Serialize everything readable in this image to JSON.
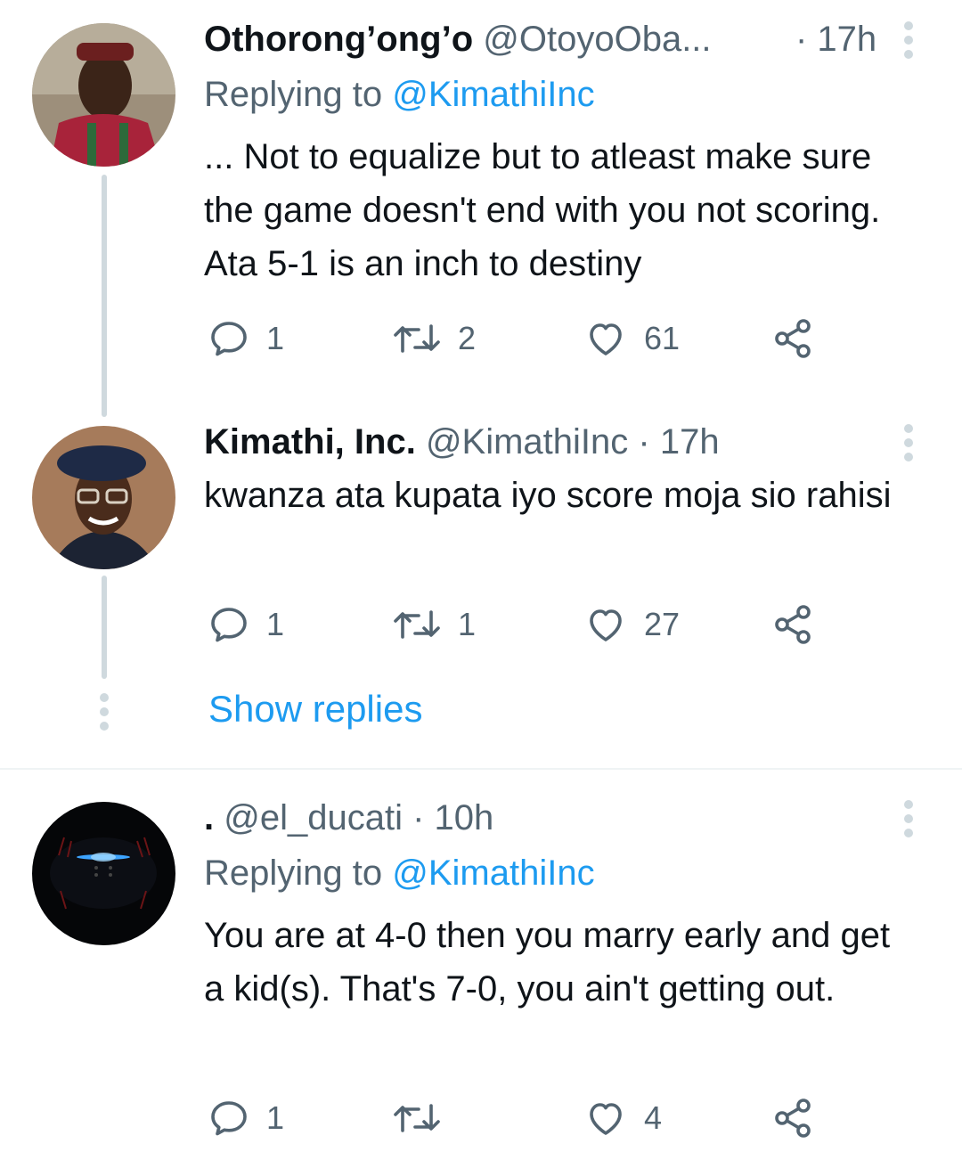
{
  "colors": {
    "accent": "#1d9bf0",
    "muted": "#536471",
    "line": "#cfd9de"
  },
  "tweets": [
    {
      "display_name": "Othorong’ong’o",
      "handle": "@OtoyoOba...",
      "time": "· 17h",
      "replying_prefix": "Replying to",
      "replying_to": "@KimathiInc",
      "text": "... Not to equalize but to atleast make sure the game doesn't end with you not scoring. Ata 5-1 is an inch to destiny",
      "replies": "1",
      "retweets": "2",
      "likes": "61"
    },
    {
      "display_name": "Kimathi, Inc.",
      "handle": "@KimathiInc",
      "time": "· 17h",
      "text": "kwanza ata kupata iyo score moja sio rahisi",
      "replies": "1",
      "retweets": "1",
      "likes": "27"
    },
    {
      "display_name": ".",
      "handle": "@el_ducati",
      "time": "· 10h",
      "replying_prefix": "Replying to",
      "replying_to": "@KimathiInc",
      "text": "You are at 4-0 then you marry early and get a kid(s). That's 7-0, you ain't getting out.",
      "replies": "1",
      "retweets": "",
      "likes": "4"
    }
  ],
  "show_replies_label": "Show replies",
  "icons": [
    "reply-icon",
    "retweet-icon",
    "like-icon",
    "share-icon",
    "more-icon"
  ]
}
